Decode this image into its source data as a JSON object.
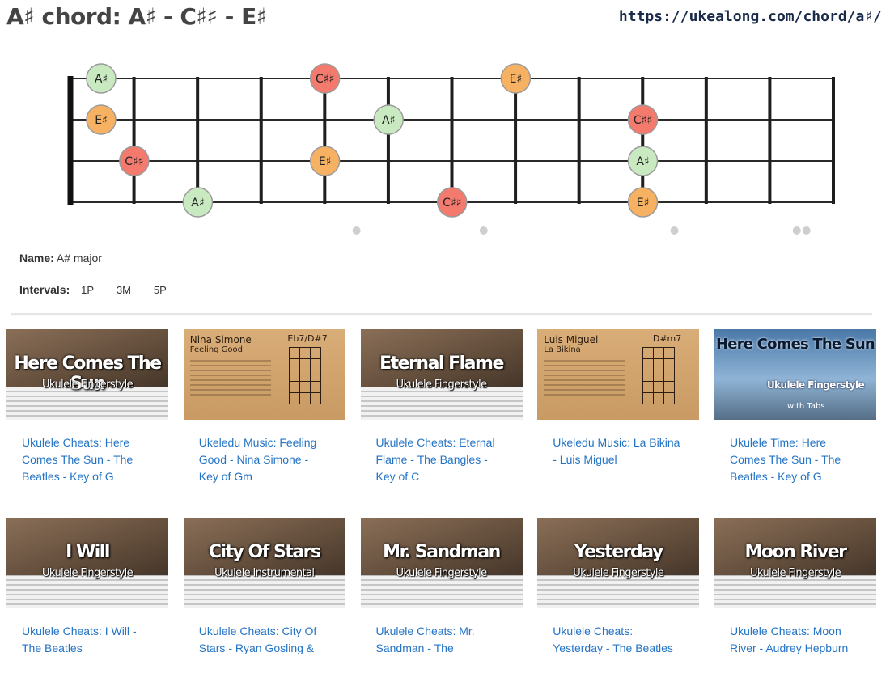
{
  "header": {
    "title": "A♯ chord: A♯ - C♯♯ - E♯",
    "url": "https://ukealong.com/chord/a♯/"
  },
  "fretboard": {
    "string_count": 4,
    "fret_count": 12,
    "fret_markers": [
      5,
      7,
      10,
      12
    ],
    "colors": {
      "root": "#c9eac0",
      "third": "#f47a6e",
      "fifth": "#f7b162"
    },
    "notes": [
      {
        "string": 1,
        "fret": 0,
        "label": "A♯",
        "role": "root"
      },
      {
        "string": 1,
        "fret": 4,
        "label": "C♯♯",
        "role": "third"
      },
      {
        "string": 1,
        "fret": 7,
        "label": "E♯",
        "role": "fifth"
      },
      {
        "string": 2,
        "fret": 0,
        "label": "E♯",
        "role": "fifth"
      },
      {
        "string": 2,
        "fret": 5,
        "label": "A♯",
        "role": "root"
      },
      {
        "string": 2,
        "fret": 9,
        "label": "C♯♯",
        "role": "third"
      },
      {
        "string": 3,
        "fret": 1,
        "label": "C♯♯",
        "role": "third"
      },
      {
        "string": 3,
        "fret": 4,
        "label": "E♯",
        "role": "fifth"
      },
      {
        "string": 3,
        "fret": 9,
        "label": "A♯",
        "role": "root"
      },
      {
        "string": 4,
        "fret": 2,
        "label": "A♯",
        "role": "root"
      },
      {
        "string": 4,
        "fret": 6,
        "label": "C♯♯",
        "role": "third"
      },
      {
        "string": 4,
        "fret": 9,
        "label": "E♯",
        "role": "fifth"
      }
    ]
  },
  "info": {
    "name_label": "Name:",
    "name_value": "A# major",
    "intervals_label": "Intervals:",
    "intervals": [
      "1P",
      "3M",
      "5P"
    ]
  },
  "videos": [
    {
      "title": "Ukulele Cheats: Here Comes The Sun - The Beatles - Key of G",
      "thumb_title": "Here Comes The Sun",
      "thumb_sub": "Ukulele Fingerstyle",
      "style": "dark"
    },
    {
      "title": "Ukeledu Music: Feeling Good - Nina Simone - Key of Gm",
      "thumb_artist": "Nina Simone",
      "thumb_song": "Feeling Good",
      "thumb_chord": "Eb7/D#7",
      "style": "paper"
    },
    {
      "title": "Ukulele Cheats: Eternal Flame - The Bangles - Key of C",
      "thumb_title": "Eternal Flame",
      "thumb_sub": "Ukulele Fingerstyle",
      "style": "dark"
    },
    {
      "title": "Ukeledu Music: La Bikina - Luis Miguel",
      "thumb_artist": "Luis Miguel",
      "thumb_song": "La Bikina",
      "thumb_chord": "D#m7",
      "style": "paper"
    },
    {
      "title": "Ukulele Time: Here Comes The Sun - The Beatles - Key of G",
      "thumb_title": "Here Comes The Sun",
      "thumb_sub": "Ukulele Fingerstyle",
      "thumb_extra": "with Tabs",
      "style": "photo"
    },
    {
      "title": "Ukulele Cheats: I Will - The Beatles",
      "thumb_title": "I Will",
      "thumb_sub": "Ukulele Fingerstyle",
      "style": "dark"
    },
    {
      "title": "Ukulele Cheats: City Of Stars - Ryan Gosling &",
      "thumb_title": "City Of Stars",
      "thumb_sub": "Ukulele Instrumental",
      "style": "dark"
    },
    {
      "title": "Ukulele Cheats: Mr. Sandman - The",
      "thumb_title": "Mr. Sandman",
      "thumb_sub": "Ukulele Fingerstyle",
      "style": "dark"
    },
    {
      "title": "Ukulele Cheats: Yesterday - The Beatles",
      "thumb_title": "Yesterday",
      "thumb_sub": "Ukulele Fingerstyle",
      "style": "dark"
    },
    {
      "title": "Ukulele Cheats: Moon River - Audrey Hepburn",
      "thumb_title": "Moon River",
      "thumb_sub": "Ukulele Fingerstyle",
      "style": "dark"
    }
  ]
}
